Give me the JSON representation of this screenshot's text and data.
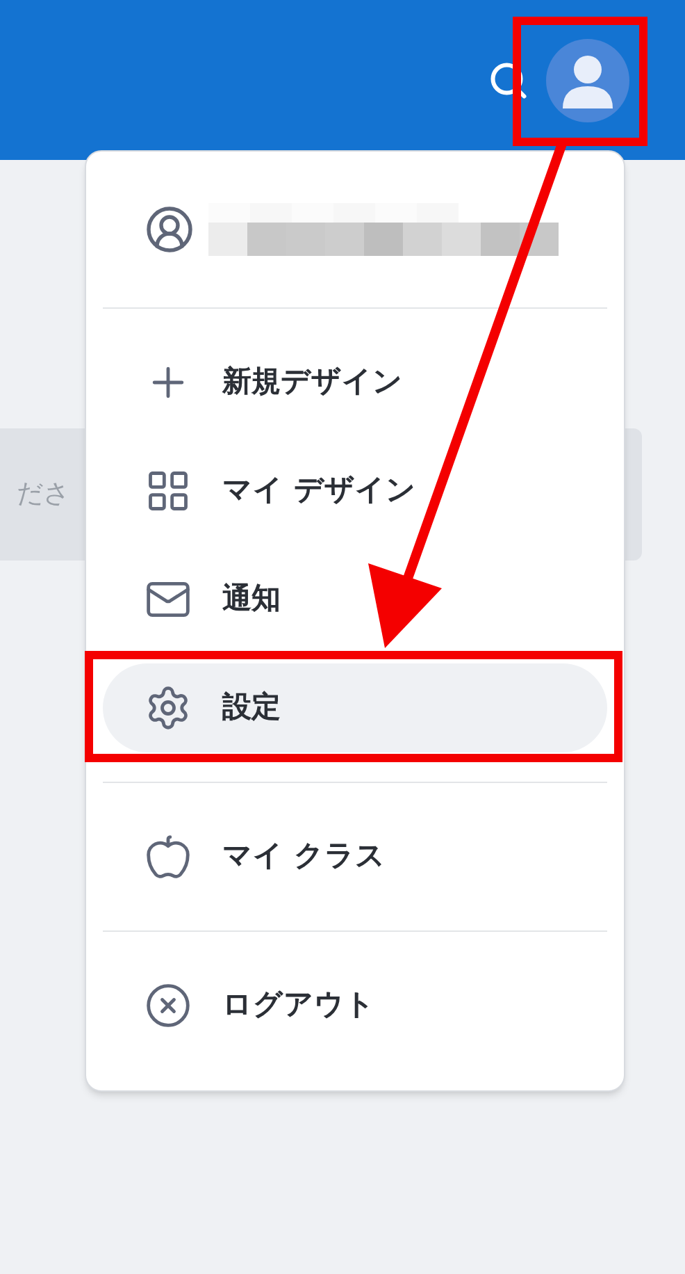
{
  "background_field": {
    "placeholder": "ださ"
  },
  "menu": {
    "groups": [
      [
        {
          "label": "新規デザイン",
          "selected": false
        },
        {
          "label": "マイ デザイン",
          "selected": false
        },
        {
          "label": "通知",
          "selected": false
        },
        {
          "label": "設定",
          "selected": true
        }
      ],
      [
        {
          "label": "マイ クラス",
          "selected": false
        }
      ],
      [
        {
          "label": "ログアウト",
          "selected": false
        }
      ]
    ]
  }
}
